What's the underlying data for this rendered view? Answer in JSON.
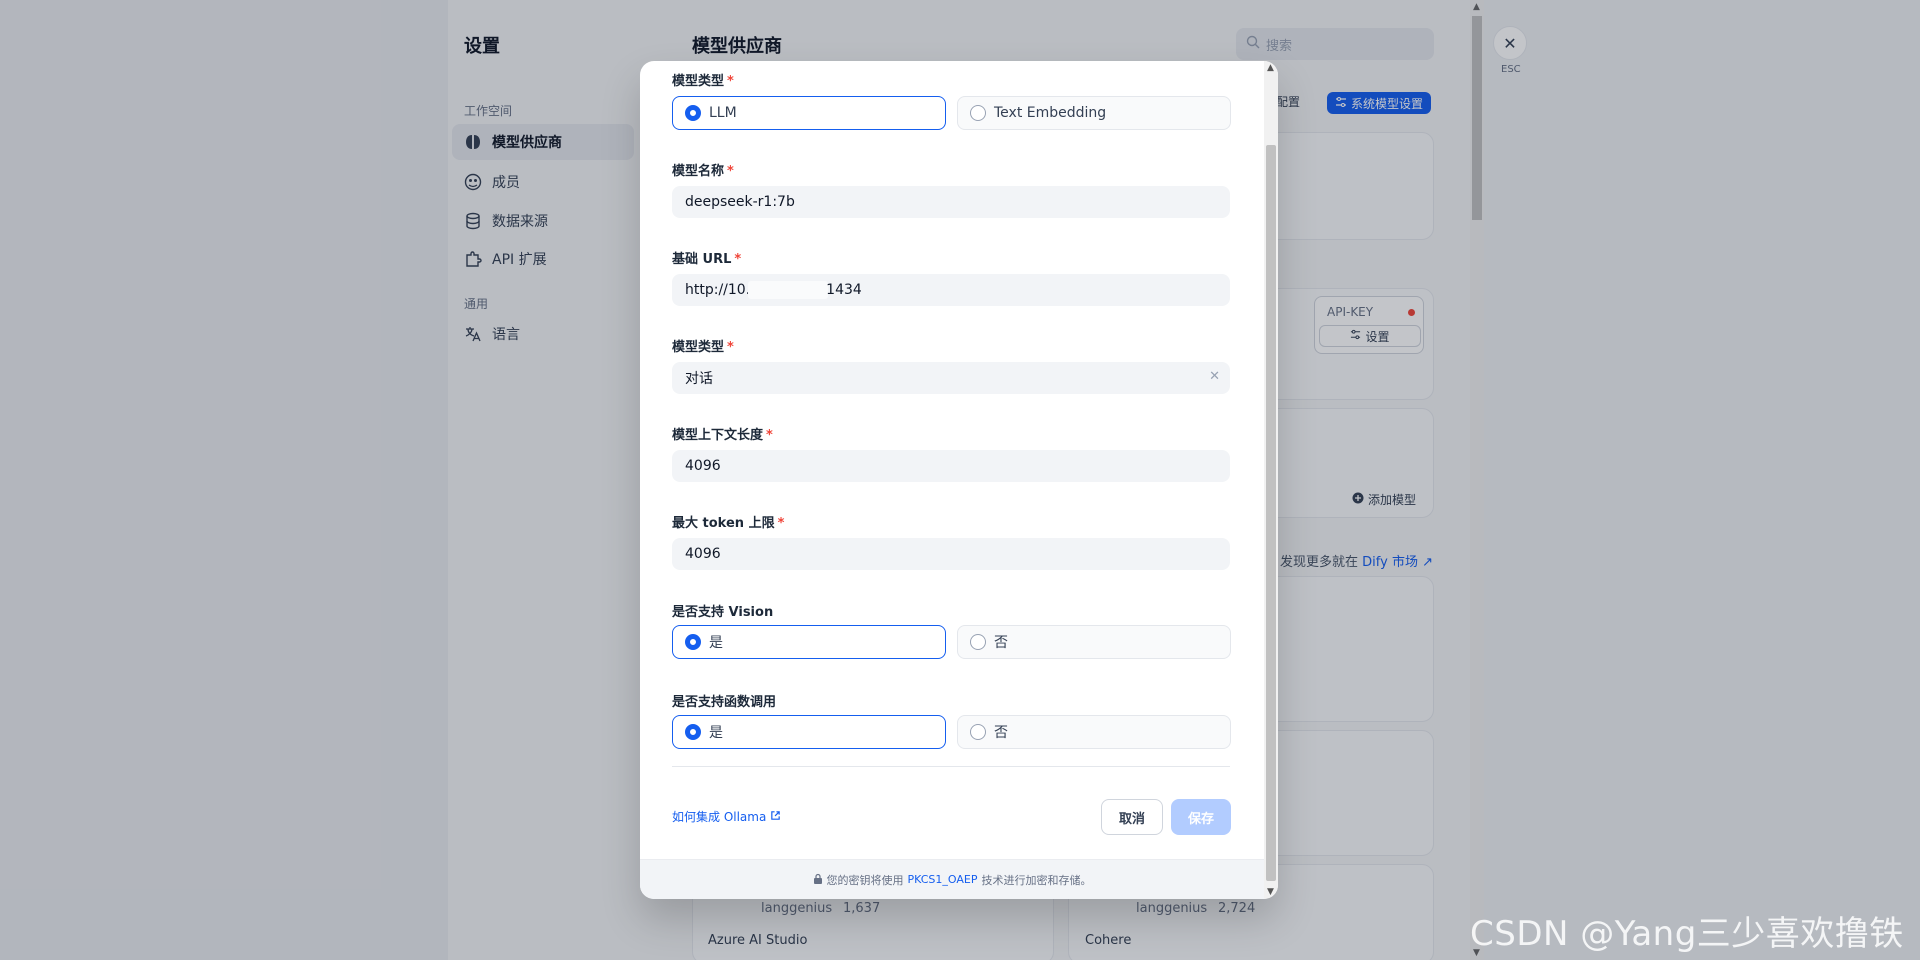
{
  "settings": {
    "title": "设置",
    "groups": {
      "workspace": "工作空间",
      "general": "通用"
    },
    "nav": [
      {
        "label": "模型供应商",
        "icon": "brain-icon"
      },
      {
        "label": "成员",
        "icon": "members-icon"
      },
      {
        "label": "数据来源",
        "icon": "database-icon"
      },
      {
        "label": "API 扩展",
        "icon": "puzzle-icon"
      },
      {
        "label": "语言",
        "icon": "translate-icon"
      }
    ]
  },
  "main": {
    "title": "模型供应商",
    "search_placeholder": "搜索",
    "partial_config_label": "全配置",
    "system_model_settings": "系统模型设置",
    "api_key_label": "API-KEY",
    "setup_label": "设置",
    "add_model_label": "添加模型",
    "discover_text": "发现更多就在",
    "discover_link": "Dify 市场",
    "providers": [
      {
        "name": "Azure AI Studio",
        "author": "langgenius",
        "installs": "1,637"
      },
      {
        "name": "Cohere",
        "author": "langgenius",
        "installs": "2,724"
      }
    ]
  },
  "close": {
    "esc_label": "ESC"
  },
  "modal": {
    "model_type_label": "模型类型",
    "model_type_options": [
      "LLM",
      "Text Embedding"
    ],
    "model_type_selected": "LLM",
    "model_name_label": "模型名称",
    "model_name_value": "deepseek-r1:7b",
    "base_url_label": "基础 URL",
    "base_url_prefix": "http://10.",
    "base_url_suffix": "1434",
    "completion_type_label": "模型类型",
    "completion_type_value": "对话",
    "context_length_label": "模型上下文长度",
    "context_length_value": "4096",
    "max_token_label": "最大 token 上限",
    "max_token_value": "4096",
    "vision_label": "是否支持 Vision",
    "vision_options": [
      "是",
      "否"
    ],
    "vision_selected": "是",
    "function_call_label": "是否支持函数调用",
    "function_call_options": [
      "是",
      "否"
    ],
    "function_call_selected": "是",
    "help_link": "如何集成 Ollama",
    "cancel_label": "取消",
    "save_label": "保存",
    "footer_prefix": "您的密钥将使用",
    "footer_link": "PKCS1_OAEP",
    "footer_suffix": "技术进行加密和存储。",
    "required_mark": "*"
  },
  "watermark": "CSDN @Yang三少喜欢撸铁",
  "colors": {
    "accent": "#155eef",
    "required": "#f04438",
    "save_disabled": "#b2ccff"
  }
}
